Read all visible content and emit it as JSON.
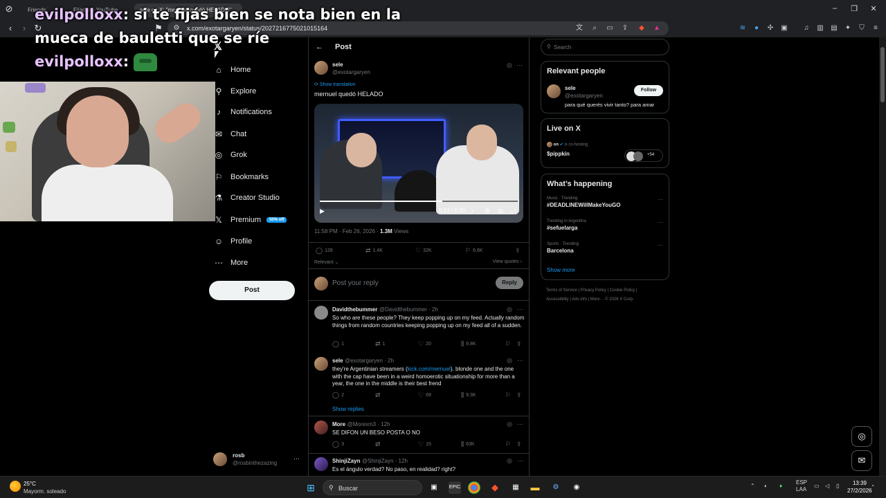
{
  "browser": {
    "tabs": [
      {
        "label": "Friends"
      },
      {
        "label": "Fijados - YouTube"
      },
      {
        "label": "sele en X: \"mernuel quedó HELADO\""
      }
    ],
    "url": "x.com/exotargaryen/status/2027216775021015164"
  },
  "chat_overlay": {
    "lines": [
      {
        "user": "evilpolloxx",
        "message": "si te fijás bien se nota bien en la mueca de bauletti que se ríe"
      },
      {
        "user": "evilpolloxx",
        "message": ""
      }
    ]
  },
  "sidebar": {
    "items": [
      {
        "label": "Home",
        "icon": "home-icon"
      },
      {
        "label": "Explore",
        "icon": "search-icon"
      },
      {
        "label": "Notifications",
        "icon": "bell-icon"
      },
      {
        "label": "Chat",
        "icon": "chat-icon"
      },
      {
        "label": "Grok",
        "icon": "grok-icon"
      },
      {
        "label": "Bookmarks",
        "icon": "bookmark-icon"
      },
      {
        "label": "Creator Studio",
        "icon": "flask-icon"
      },
      {
        "label": "Premium",
        "icon": "x-logo-icon",
        "badge": "50% off"
      },
      {
        "label": "Profile",
        "icon": "person-icon"
      },
      {
        "label": "More",
        "icon": "more-circle-icon"
      }
    ],
    "post_button": "Post",
    "account": {
      "name": "rosb",
      "handle": "@rosbinthezazing"
    }
  },
  "main": {
    "header_title": "Post",
    "post": {
      "author": "sele",
      "handle": "@exotargaryen",
      "show_translation": "Show translation",
      "text": "mernuel quedó HELADO",
      "video_time": "0:13 / 0:20",
      "timestamp": "11:58 PM · Feb 26, 2026 · ",
      "views_count": "1.3M",
      "views_label": " Views",
      "stats": {
        "replies": "128",
        "reposts": "1.4K",
        "likes": "32K",
        "bookmarks": "6.6K"
      },
      "sort_label": "Relevant",
      "view_quotes": "View quotes"
    },
    "reply_placeholder": "Post your reply",
    "reply_button": "Reply",
    "replies": [
      {
        "name": "Davidthebummer",
        "handle": "@Davidthebummer · 2h",
        "text": "So who are these people? They keep popping up on my feed. Actually random things from random countries keeping popping up on my feed all of a sudden.",
        "replies": "1",
        "reposts": "1",
        "likes": "20",
        "views": "9.8K"
      },
      {
        "name": "sele",
        "handle": "@exotargaryen · 2h",
        "text_before": "they're Argentinian streamers (",
        "link": "kick.com/mernuel",
        "text_after": "). blonde one and the one with the cap have been in a weird homoerotic situationship for more than a year, the one in the middle is their best frend",
        "replies": "2",
        "reposts": "",
        "likes": "69",
        "views": "9.3K",
        "show_replies": "Show replies"
      },
      {
        "name": "More",
        "handle": "@Morexm3 · 12h",
        "text": "SE DIFON UN BESO POSTA O NO",
        "replies": "3",
        "reposts": "",
        "likes": "15",
        "views": "63K"
      },
      {
        "name": "ShinjiZayn",
        "handle": "@ShinjiZayn · 12h",
        "text": "Es el ángulo verdad? No paso, en realidad? right?"
      }
    ]
  },
  "right": {
    "search_placeholder": "Search",
    "relevant_people": {
      "title": "Relevant people",
      "name": "sele",
      "handle": "@exotargaryen",
      "bio": "para qué querés vivir tanto? para amar",
      "follow": "Follow"
    },
    "live": {
      "title": "Live on X",
      "host_prefix": "on",
      "host_suffix": "is co-hosting",
      "name": "$pippkin",
      "count": "+54"
    },
    "happening": {
      "title": "What’s happening",
      "trends": [
        {
          "category": "Music · Trending",
          "name": "#DEADLINEWillMakeYouGO"
        },
        {
          "category": "Trending in Argentina",
          "name": "#sefuelarga"
        },
        {
          "category": "Sports · Trending",
          "name": "Barcelona"
        }
      ],
      "show_more": "Show more"
    },
    "footer": {
      "line1": "Terms of Service  |  Privacy Policy  |  Cookie Policy  |",
      "line2": "Accessibility  |  Ads info  |  More···  © 2026 X Corp."
    }
  },
  "taskbar": {
    "temperature": "25°C",
    "weather": "Mayorm. soleado",
    "search_label": "Buscar",
    "lang_top": "ESP",
    "lang_bottom": "LAA",
    "time": "13:39",
    "date": "27/2/2026"
  },
  "colors": {
    "accent": "#1d9bf0",
    "background": "#000000",
    "border": "#2f3336",
    "muted": "#71767b"
  }
}
